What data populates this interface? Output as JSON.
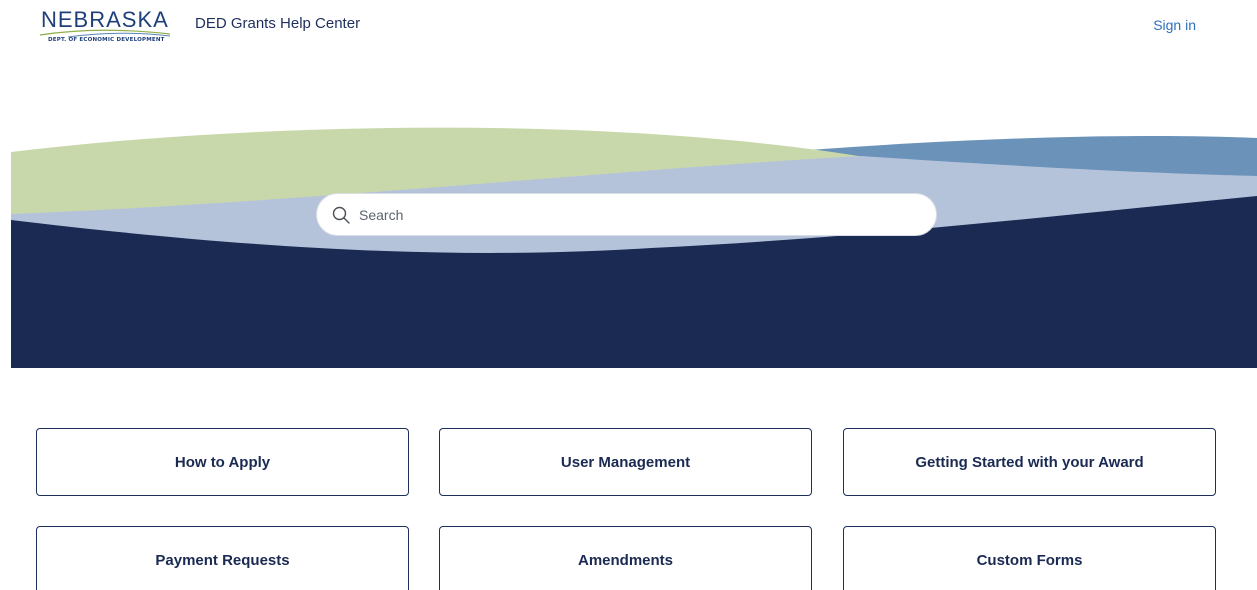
{
  "header": {
    "logo_text": "NEBRASKA",
    "logo_subtext": "DEPT. OF ECONOMIC DEVELOPMENT",
    "site_title": "DED Grants Help Center",
    "sign_in_label": "Sign in"
  },
  "search": {
    "placeholder": "Search",
    "value": ""
  },
  "categories": [
    {
      "label": "How to Apply"
    },
    {
      "label": "User Management"
    },
    {
      "label": "Getting Started with your Award"
    },
    {
      "label": "Payment Requests"
    },
    {
      "label": "Amendments"
    },
    {
      "label": "Custom Forms"
    }
  ],
  "colors": {
    "navy": "#1a2a52",
    "green": "#c9d8ab",
    "light_blue": "#b4c3da",
    "steel_blue": "#6b92b8",
    "link": "#2f6fb8"
  }
}
